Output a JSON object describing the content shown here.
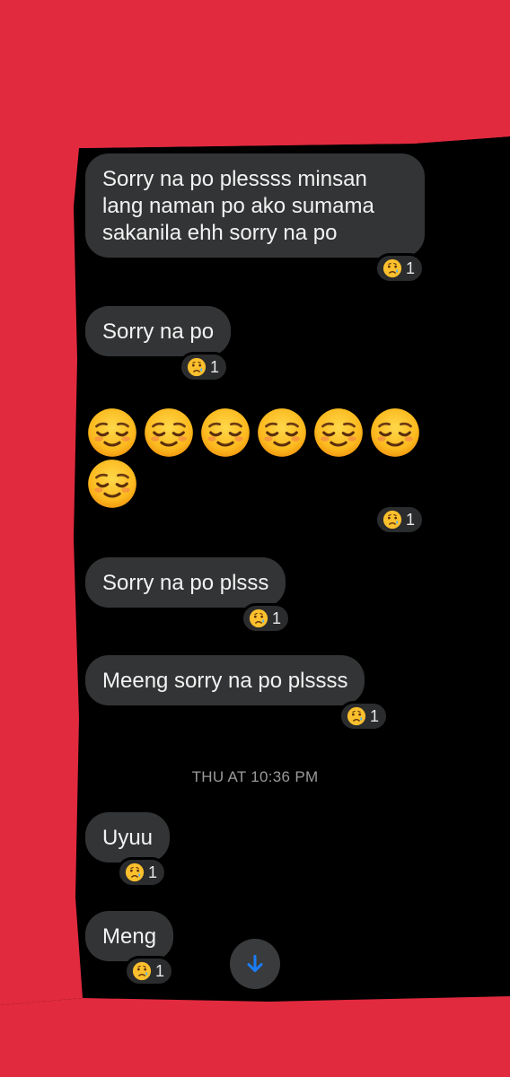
{
  "messages": [
    {
      "text_lines": [
        "Sorry na po plessss minsan",
        "lang naman po ako sumama",
        "sakanila ehh sorry na po"
      ],
      "reaction": {
        "icon": "crying-face-icon",
        "count": "1"
      }
    },
    {
      "text": "Sorry na po",
      "reaction": {
        "icon": "crying-face-icon",
        "count": "1"
      }
    },
    {
      "emoji": "relieved-face-icon",
      "emoji_count": 7,
      "reaction": {
        "icon": "crying-face-icon",
        "count": "1"
      }
    },
    {
      "text": "Sorry na po plsss",
      "reaction": {
        "icon": "crying-face-icon",
        "count": "1"
      }
    },
    {
      "text": "Meeng sorry na po plssss",
      "reaction": {
        "icon": "crying-face-icon",
        "count": "1"
      }
    },
    {
      "text": "Uyuu",
      "reaction": {
        "icon": "crying-face-icon",
        "count": "1"
      }
    },
    {
      "text": "Meng",
      "reaction": {
        "icon": "crying-face-icon",
        "count": "1"
      }
    }
  ],
  "timestamp": "THU AT 10:36 PM",
  "scroll_button": {
    "icon": "arrow-down-icon"
  },
  "colors": {
    "scribble": "#e12a3e",
    "bubble": "#333435",
    "chat_bg": "#000000",
    "accent": "#1a7cf5"
  }
}
